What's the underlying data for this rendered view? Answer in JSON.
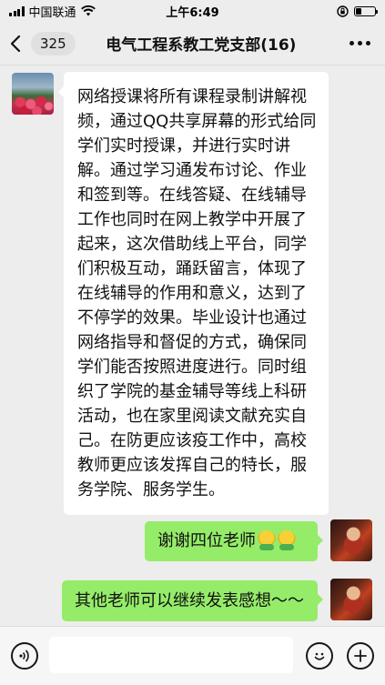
{
  "status_bar": {
    "carrier": "中国联通",
    "time": "上午6:49",
    "battery_level": 0.3
  },
  "nav": {
    "unread_count": "325",
    "title": "电气工程系教工党支部(16)"
  },
  "messages": [
    {
      "side": "left",
      "avatar": "tulip-field-avatar",
      "text": "网络授课将所有课程录制讲解视频，通过QQ共享屏幕的形式给同学们实时授课，并进行实时讲解。通过学习通发布讨论、作业和签到等。在线答疑、在线辅导工作也同时在网上教学中开展了起来，这次借助线上平台，同学们积极互动，踊跃留言，体现了在线辅导的作用和意义，达到了不停学的效果。毕业设计也通过网络指导和督促的方式，确保同学们能否按照进度进行。同时组织了学院的基金辅导等线上科研活动，也在家里阅读文献充实自己。在防更应该疫工作中，高校教师更应该发挥自己的特长，服务学院、服务学生。"
    },
    {
      "side": "right",
      "avatar": "self-avatar",
      "text": "谢谢四位老师",
      "emojis": [
        "applause-emoji",
        "applause-emoji"
      ]
    },
    {
      "side": "right",
      "avatar": "self-avatar",
      "text": "其他老师可以继续发表感想～～"
    }
  ],
  "input_bar": {
    "voice_icon": "voice-icon",
    "emoji_icon": "emoji-icon",
    "plus_icon": "plus-icon"
  },
  "colors": {
    "background": "#ededed",
    "bubble_left": "#ffffff",
    "bubble_right": "#95ec69"
  }
}
